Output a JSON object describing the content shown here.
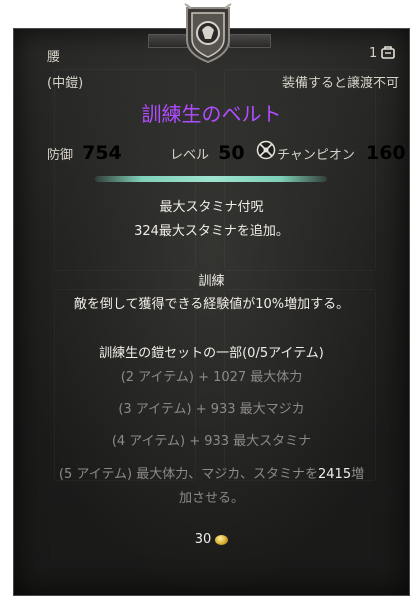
{
  "item": {
    "slot": "腰",
    "count": "1",
    "weight_class": "(中鎧)",
    "bind_text": "装備すると譲渡不可",
    "name": "訓練生のベルト",
    "name_color": "#b04cff"
  },
  "stats": {
    "armor_label": "防御",
    "armor_value": "754",
    "level_label": "レベル",
    "level_value": "50",
    "champion_label": "チャンピオン",
    "champion_value": "160"
  },
  "enchant": {
    "title": "最大スタミナ付呪",
    "desc_value": "324",
    "desc_text": "最大スタミナを追加。"
  },
  "trait": {
    "title": "訓練",
    "desc_prefix": "敵を倒して獲得できる経験値が",
    "desc_value": "10%",
    "desc_suffix": "増加する。"
  },
  "set": {
    "title": "訓練生の鎧セットの一部(0/5アイテム)",
    "bonuses": [
      {
        "label": "(2 アイテム) + 1027 最大体力"
      },
      {
        "label": "(3 アイテム) + 933 最大マジカ"
      },
      {
        "label": "(4 アイテム) + 933 最大スタミナ"
      }
    ],
    "bonus5_prefix": "(5 アイテム) 最大体力、マジカ、スタミナを",
    "bonus5_value": "2415",
    "bonus5_suffix": "増",
    "bonus5_line2": "加させる。"
  },
  "value": {
    "gold": "30",
    "icon": "gold-coin-icon"
  },
  "icons": [
    "emblem-icon",
    "inventory-bag-icon",
    "champion-icon",
    "gold-coin-icon"
  ]
}
